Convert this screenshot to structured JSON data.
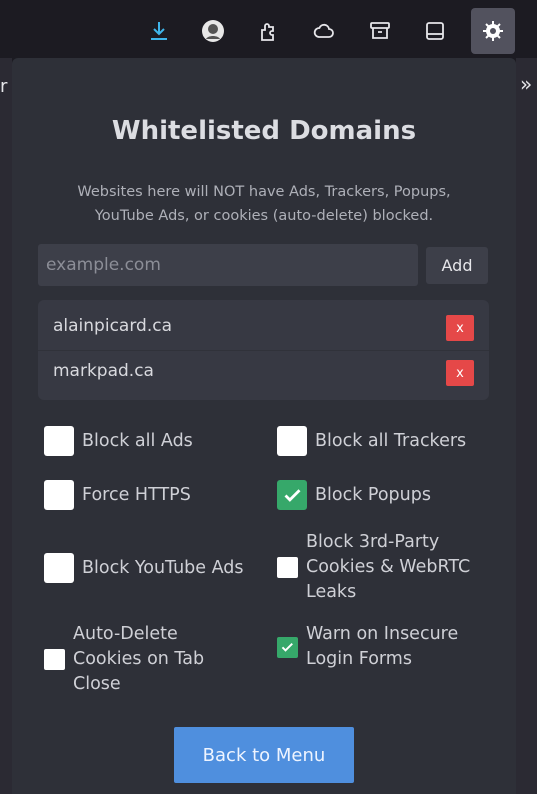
{
  "toolbar": {
    "icons": [
      "download-icon",
      "avatar-icon",
      "extensions-icon",
      "cloud-icon",
      "archive-icon",
      "sidebar-icon",
      "shield-extension-icon"
    ],
    "overflow": "»",
    "left_fragment": "r"
  },
  "panel": {
    "title": "Whitelisted Domains",
    "subtitle": "Websites here will NOT have Ads, Trackers, Popups, YouTube Ads, or cookies (auto-delete) blocked.",
    "input_placeholder": "example.com",
    "add_label": "Add",
    "domains": [
      {
        "name": "alainpicard.ca",
        "remove": "x"
      },
      {
        "name": "markpad.ca",
        "remove": "x"
      }
    ],
    "options": [
      {
        "label": "Block all Ads",
        "checked": false
      },
      {
        "label": "Block all Trackers",
        "checked": false
      },
      {
        "label": "Force HTTPS",
        "checked": false
      },
      {
        "label": "Block Popups",
        "checked": true
      },
      {
        "label": "Block YouTube Ads",
        "checked": false
      },
      {
        "label": "Block 3rd-Party Cookies & WebRTC Leaks",
        "checked": false
      },
      {
        "label": "Auto-Delete Cookies on Tab Close",
        "checked": false
      },
      {
        "label": "Warn on Insecure Login Forms",
        "checked": true
      }
    ],
    "back_label": "Back to Menu"
  },
  "colors": {
    "accent": "#4f8fde",
    "checked": "#36a86a",
    "remove": "#e54848"
  }
}
